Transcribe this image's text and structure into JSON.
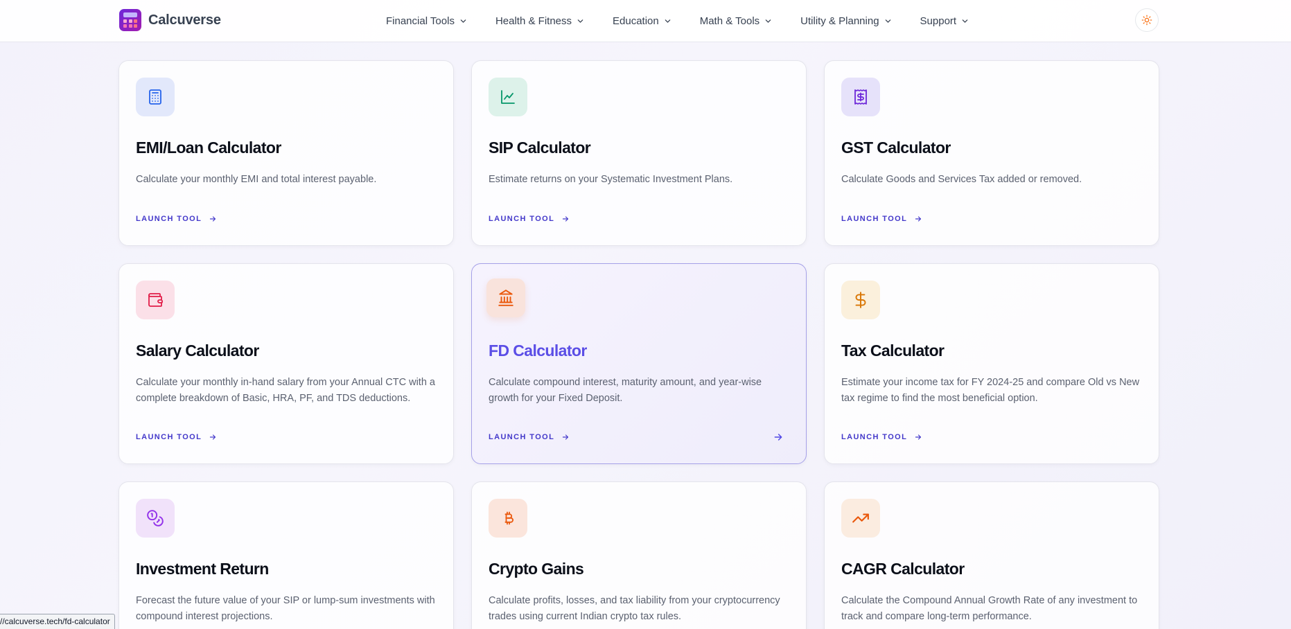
{
  "brand": {
    "name": "Calcuverse"
  },
  "nav": [
    "Financial Tools",
    "Health & Fitness",
    "Education",
    "Math & Tools",
    "Utility & Planning",
    "Support"
  ],
  "launch_label": "LAUNCH TOOL",
  "cards": [
    {
      "title": "EMI/Loan Calculator",
      "desc": "Calculate your monthly EMI and total interest payable.",
      "icon": "calculator-icon",
      "color": "#2563eb"
    },
    {
      "title": "SIP Calculator",
      "desc": "Estimate returns on your Systematic Investment Plans.",
      "icon": "line-chart-icon",
      "color": "#059669"
    },
    {
      "title": "GST Calculator",
      "desc": "Calculate Goods and Services Tax added or removed.",
      "icon": "receipt-dollar-icon",
      "color": "#6d28d9"
    },
    {
      "title": "Salary Calculator",
      "desc": "Calculate your monthly in-hand salary from your Annual CTC with a complete breakdown of Basic, HRA, PF, and TDS deductions.",
      "icon": "wallet-icon",
      "color": "#e11d48"
    },
    {
      "title": "FD Calculator",
      "desc": "Calculate compound interest, maturity amount, and year-wise growth for your Fixed Deposit.",
      "icon": "bank-icon",
      "color": "#ea580c"
    },
    {
      "title": "Tax Calculator",
      "desc": "Estimate your income tax for FY 2024-25 and compare Old vs New tax regime to find the most beneficial option.",
      "icon": "dollar-icon",
      "color": "#d97706"
    },
    {
      "title": "Investment Return",
      "desc": "Forecast the future value of your SIP or lump-sum investments with compound interest projections.",
      "icon": "coins-icon",
      "color": "#9333ea"
    },
    {
      "title": "Crypto Gains",
      "desc": "Calculate profits, losses, and tax liability from your cryptocurrency trades using current Indian crypto tax rules.",
      "icon": "bitcoin-icon",
      "color": "#ea580c"
    },
    {
      "title": "CAGR Calculator",
      "desc": "Calculate the Compound Annual Growth Rate of any investment to track and compare long-term performance.",
      "icon": "trending-up-icon",
      "color": "#ea580c"
    }
  ],
  "status_url": "//calcuverse.tech/fd-calculator"
}
